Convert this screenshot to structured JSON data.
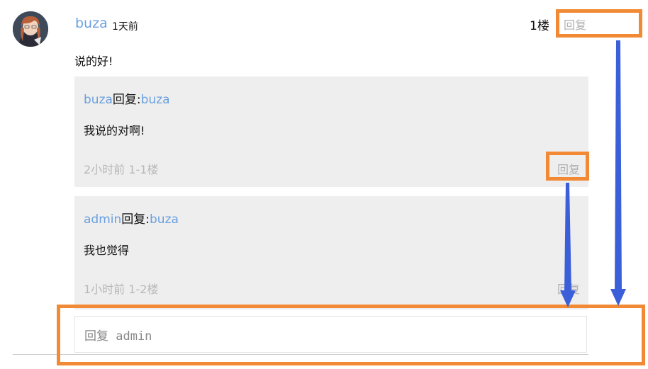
{
  "comment": {
    "username": "buza",
    "time": "1天前",
    "floor": "1楼",
    "reply_label": "回复",
    "content": "说的好!"
  },
  "replies": [
    {
      "from": "buza",
      "action": "回复",
      "separator": ":",
      "to": "buza",
      "content": "我说的对啊!",
      "meta": "2小时前 1-1楼",
      "reply_label": "回复"
    },
    {
      "from": "admin",
      "action": "回复",
      "separator": ":",
      "to": "buza",
      "content": "我也觉得",
      "meta": "1小时前 1-2楼",
      "reply_label": "回复"
    }
  ],
  "reply_input": {
    "placeholder": "回复 admin"
  },
  "colors": {
    "link": "#6aa0e0",
    "highlight": "#f28a35",
    "arrow": "#3a5fd9",
    "card_bg": "#eeeeee"
  }
}
